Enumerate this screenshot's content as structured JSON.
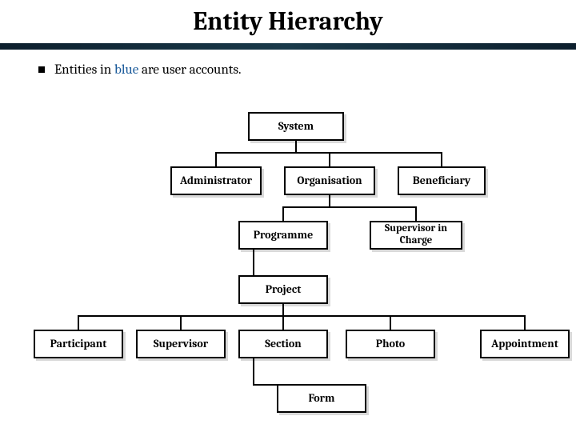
{
  "title": "Entity Hierarchy",
  "subtitle_prefix": "Entities in ",
  "subtitle_blue": "blue",
  "subtitle_suffix": " are user accounts.",
  "nodes": {
    "system": "System",
    "administrator": "Administrator",
    "organisation": "Organisation",
    "beneficiary": "Beneficiary",
    "programme": "Programme",
    "supervisor_in_charge": "Supervisor in Charge",
    "project": "Project",
    "participant": "Participant",
    "supervisor": "Supervisor",
    "section": "Section",
    "photo": "Photo",
    "appointment": "Appointment",
    "form": "Form"
  },
  "colors": {
    "blue_text": "#1a5a9a",
    "header_dark": "#0d1f2d"
  }
}
